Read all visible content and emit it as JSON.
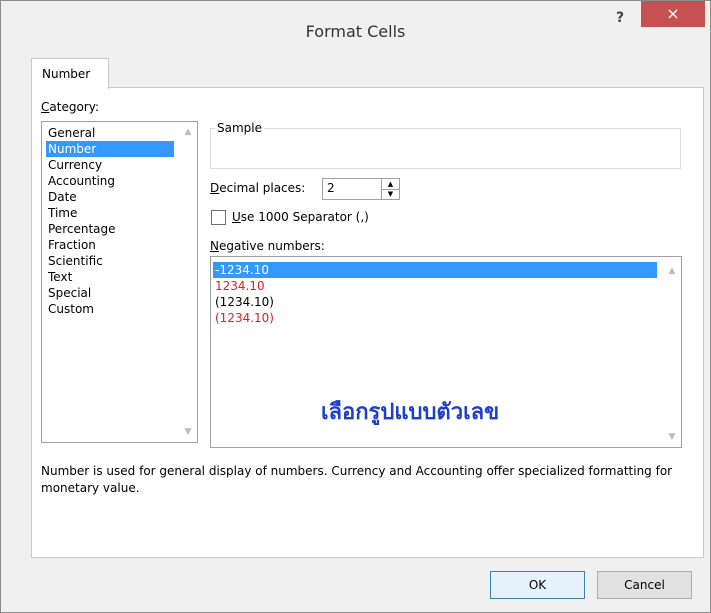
{
  "window": {
    "title": "Format Cells",
    "help_label": "?",
    "close_label": "×"
  },
  "tabs": [
    {
      "label": "Number",
      "active": true
    }
  ],
  "category": {
    "label": "Category:",
    "items": [
      "General",
      "Number",
      "Currency",
      "Accounting",
      "Date",
      "Time",
      "Percentage",
      "Fraction",
      "Scientific",
      "Text",
      "Special",
      "Custom"
    ],
    "selected": "Number"
  },
  "sample": {
    "label": "Sample",
    "value": ""
  },
  "decimal_places": {
    "label": "Decimal places:",
    "value": "2"
  },
  "separator": {
    "label": "Use 1000 Separator (,)",
    "checked": false
  },
  "negative_numbers": {
    "label": "Negative numbers:",
    "items": [
      {
        "text": "-1234.10",
        "color": "#000000",
        "selected": true
      },
      {
        "text": "1234.10",
        "color": "#e51c23",
        "selected": false
      },
      {
        "text": "(1234.10)",
        "color": "#000000",
        "selected": false
      },
      {
        "text": "(1234.10)",
        "color": "#e51c23",
        "selected": false
      }
    ]
  },
  "annotation": {
    "text": "เลือกรูปแบบตัวเลข",
    "color": "#1f3fc4"
  },
  "description": {
    "text": "Number is used for general display of numbers.  Currency and Accounting offer specialized formatting for monetary value."
  },
  "buttons": {
    "ok_label": "OK",
    "cancel_label": "Cancel"
  }
}
